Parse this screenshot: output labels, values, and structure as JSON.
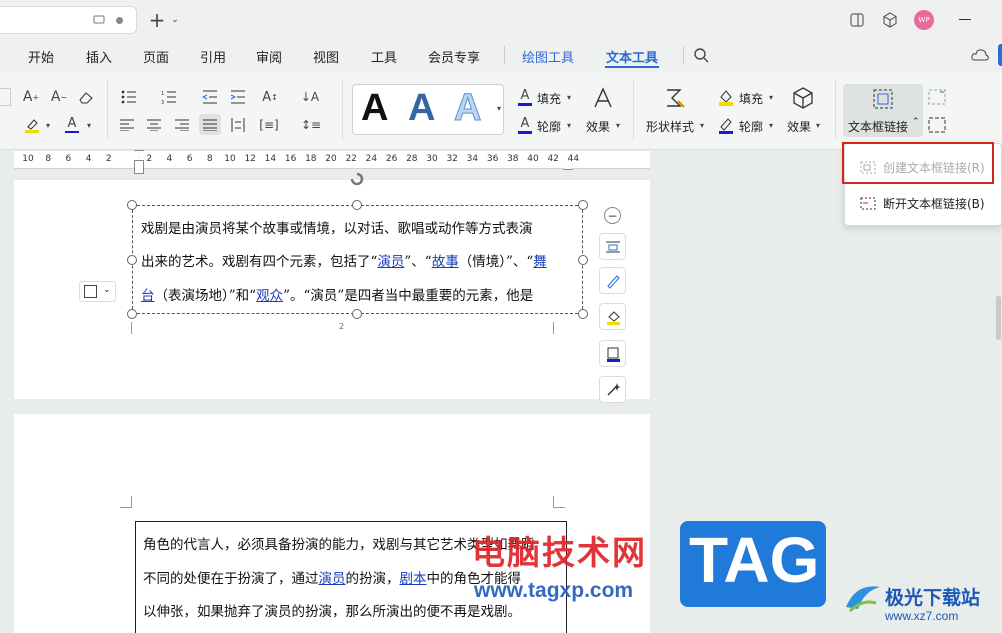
{
  "window": {
    "avatar_text": "WP"
  },
  "menu": {
    "items": [
      "开始",
      "插入",
      "页面",
      "引用",
      "审阅",
      "视图",
      "工具",
      "会员专享"
    ],
    "context_items": [
      "绘图工具",
      "文本工具"
    ],
    "active": "文本工具"
  },
  "ribbon": {
    "fill_label": "填充",
    "outline_label": "轮廓",
    "effect_label": "效果",
    "shape_style_label": "形状样式",
    "fill2_label": "填充",
    "outline2_label": "轮廓",
    "effect2_label": "效果",
    "textbox_link_label": "文本框链接",
    "art_letters": [
      "A",
      "A",
      "A"
    ]
  },
  "ruler": {
    "ticks": [
      "10",
      "8",
      "6",
      "4",
      "2",
      "",
      "2",
      "4",
      "6",
      "8",
      "10",
      "12",
      "14",
      "16",
      "18",
      "20",
      "22",
      "24",
      "26",
      "28",
      "30",
      "32",
      "34",
      "36",
      "38",
      "40",
      "42",
      "44"
    ]
  },
  "page1": {
    "lines": [
      [
        "戏剧是由演员将某个故事或情境，以对话、歌唱或动作等方式表演"
      ],
      [
        "出来的艺术。戏剧有四个元素，包括了“",
        "演员",
        "”、“",
        "故事",
        "（情境）”、“",
        "舞"
      ],
      [
        "台",
        "（表演场地）”和“",
        "观众",
        "”。“演员”是四者当中最重要的元素，他是"
      ]
    ],
    "page_number": "2"
  },
  "page2": {
    "lines": [
      [
        "角色的代言人，必须具备扮演的能力，戏剧与其它艺术类型如舞蹈"
      ],
      [
        "不同的处便在于扮演了，通过",
        "演员",
        "的扮演，",
        "剧本",
        "中的角色才能得"
      ],
      [
        "以伸张，如果抛弃了演员的扮演，那么所演出的便不再是戏剧。"
      ]
    ]
  },
  "dropdown": {
    "create_link": "创建文本框链接(R)",
    "break_link": "断开文本框链接(B)"
  },
  "watermark": {
    "site_cn": "电脑技术网",
    "site_url": "www.tagxp.com",
    "tag": "TAG",
    "brand": "极光下载站",
    "brand_url": "www.xz7.com"
  },
  "colors": {
    "accent": "#2d6bd4",
    "highlight_box": "#d0281e",
    "tag_blue": "#1f7ad9",
    "watermark_red": "#e0242a"
  }
}
